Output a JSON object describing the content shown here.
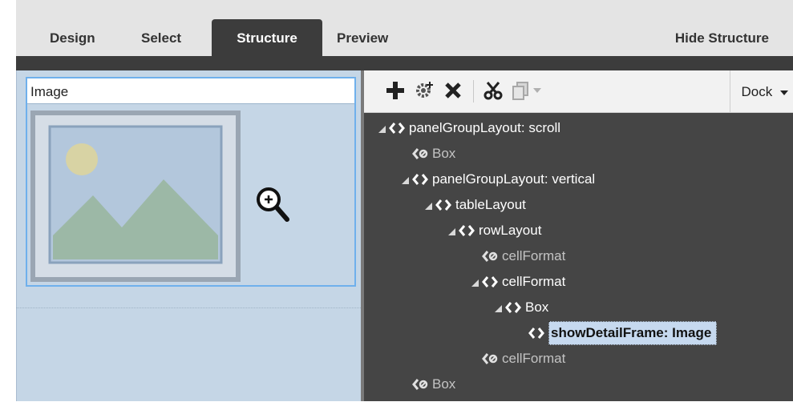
{
  "tabs": [
    {
      "label": "Design",
      "active": false
    },
    {
      "label": "Select",
      "active": false
    },
    {
      "label": "Structure",
      "active": true
    },
    {
      "label": "Preview",
      "active": false
    }
  ],
  "hide_structure_label": "Hide Structure",
  "image_component": {
    "title": "Image"
  },
  "toolbar": {
    "icons": [
      "plus-icon",
      "gear-plus-icon",
      "delete-icon",
      "cut-icon",
      "copy-icon",
      "dropdown-arrow-icon"
    ],
    "dock_label": "Dock"
  },
  "tree": [
    {
      "label": "panelGroupLayout: scroll",
      "expanded": true,
      "dim": false,
      "selected": false
    },
    {
      "label": "Box",
      "expanded": false,
      "dim": true,
      "selected": false
    },
    {
      "label": "panelGroupLayout: vertical",
      "expanded": true,
      "dim": false,
      "selected": false
    },
    {
      "label": "tableLayout",
      "expanded": true,
      "dim": false,
      "selected": false
    },
    {
      "label": "rowLayout",
      "expanded": true,
      "dim": false,
      "selected": false
    },
    {
      "label": "cellFormat",
      "expanded": false,
      "dim": true,
      "selected": false
    },
    {
      "label": "cellFormat",
      "expanded": true,
      "dim": false,
      "selected": false
    },
    {
      "label": "Box",
      "expanded": true,
      "dim": false,
      "selected": false
    },
    {
      "label": "showDetailFrame: Image",
      "expanded": false,
      "dim": false,
      "selected": true
    },
    {
      "label": "cellFormat",
      "expanded": false,
      "dim": true,
      "selected": false
    },
    {
      "label": "Box",
      "expanded": false,
      "dim": true,
      "selected": false
    }
  ],
  "colors": {
    "dark": "#3c3c3c",
    "tree_bg": "#454545",
    "canvas": "#c5d6e6",
    "selection_border": "#6fb0ec",
    "selected_node": "#c6d9ef"
  }
}
